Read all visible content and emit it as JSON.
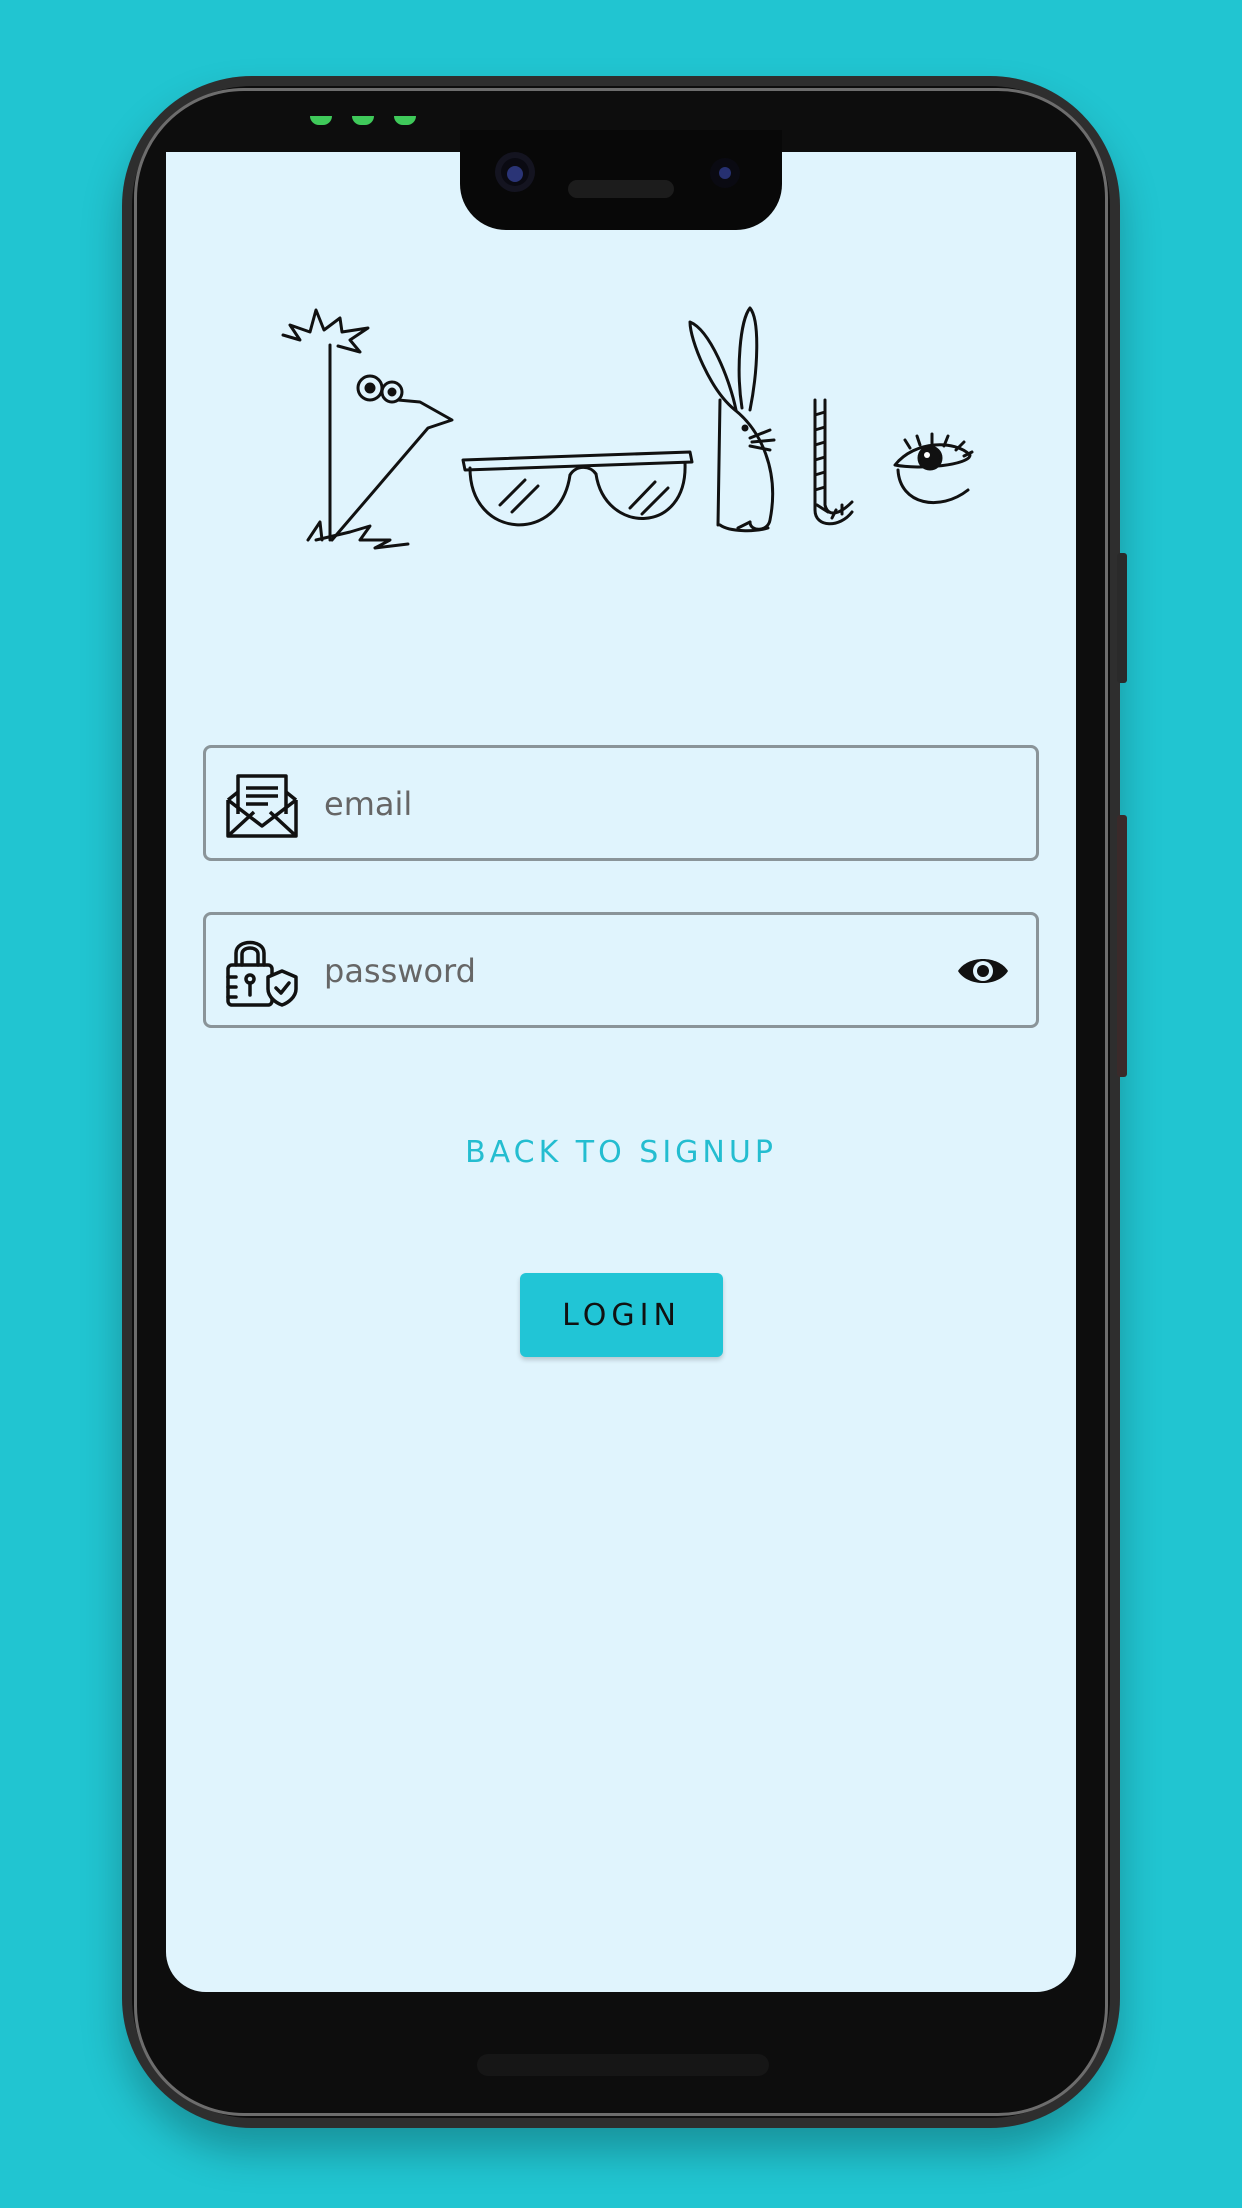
{
  "app": {
    "logo_text": "Doodle"
  },
  "login_form": {
    "email": {
      "placeholder": "email",
      "value": "",
      "icon": "envelope-letter-icon"
    },
    "password": {
      "placeholder": "password",
      "value": "",
      "icon": "padlock-shield-icon",
      "toggle_icon": "eye-icon"
    },
    "back_link_label": "BACK TO SIGNUP",
    "login_label": "LOGIN"
  },
  "theme": {
    "background": "#21c5d1",
    "screen_background": "#e0f4fd",
    "accent": "#21c5d6",
    "field_border": "#8a9499"
  }
}
